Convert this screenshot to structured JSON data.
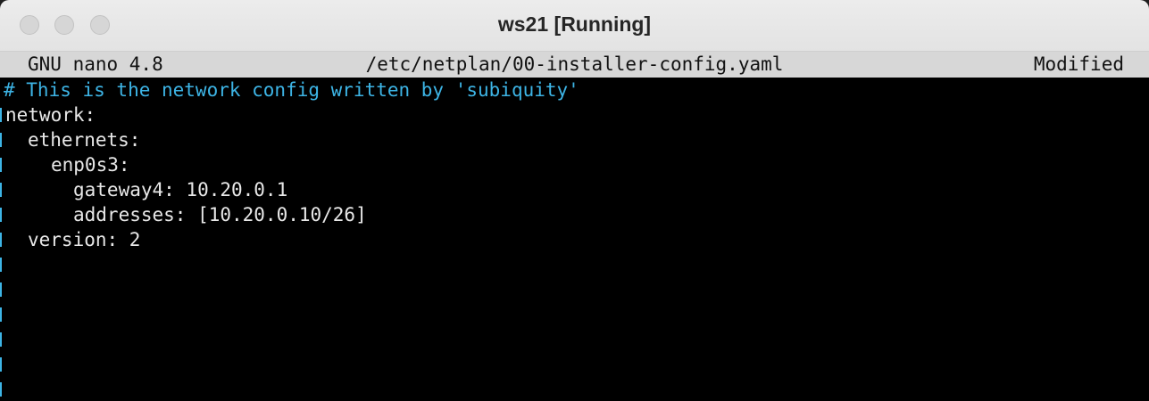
{
  "window": {
    "title": "ws21 [Running]"
  },
  "nano": {
    "version": "GNU nano 4.8",
    "filename": "/etc/netplan/00-installer-config.yaml",
    "status": "Modified"
  },
  "file_lines": [
    "# This is the network config written by 'subiquity'",
    "network:",
    "ethernets:",
    "enp0s3:",
    "gateway4: 10.20.0.1",
    "addresses: [10.20.0.10/26]",
    "version: 2"
  ],
  "colors": {
    "comment": "#3db4e5",
    "text": "#e8e8e8",
    "background": "#000000",
    "statusbar": "#d7d7d7"
  }
}
